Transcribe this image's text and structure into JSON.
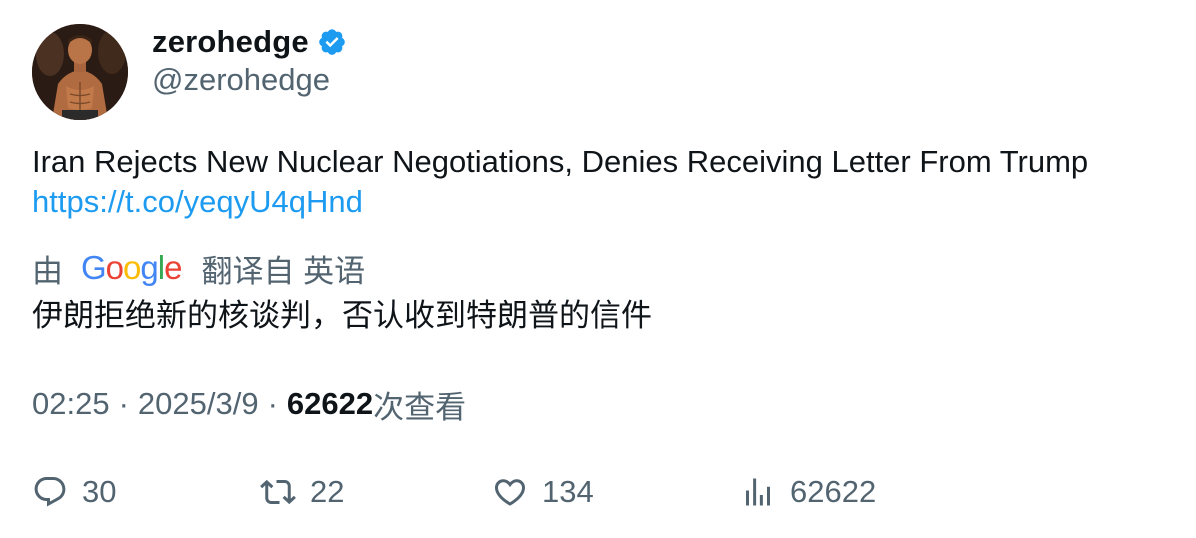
{
  "author": {
    "display_name": "zerohedge",
    "handle": "@zerohedge",
    "verified": true,
    "verified_color": "#1d9bf0"
  },
  "tweet": {
    "text": "Iran Rejects New Nuclear Negotiations, Denies Receiving Letter From Trump",
    "link": "https://t.co/yeqyU4qHnd"
  },
  "translation": {
    "by_label": "由",
    "provider": "Google",
    "from_label": "翻译自 英语",
    "translated_text": "伊朗拒绝新的核谈判，否认收到特朗普的信件"
  },
  "meta": {
    "time": "02:25",
    "separator": "·",
    "date": "2025/3/9",
    "views_count": "62622",
    "views_label": "次查看"
  },
  "actions": {
    "reply_count": "30",
    "retweet_count": "22",
    "like_count": "134",
    "views_count": "62622"
  },
  "colors": {
    "text": "#0f1419",
    "secondary": "#536471",
    "link": "#1d9bf0"
  }
}
